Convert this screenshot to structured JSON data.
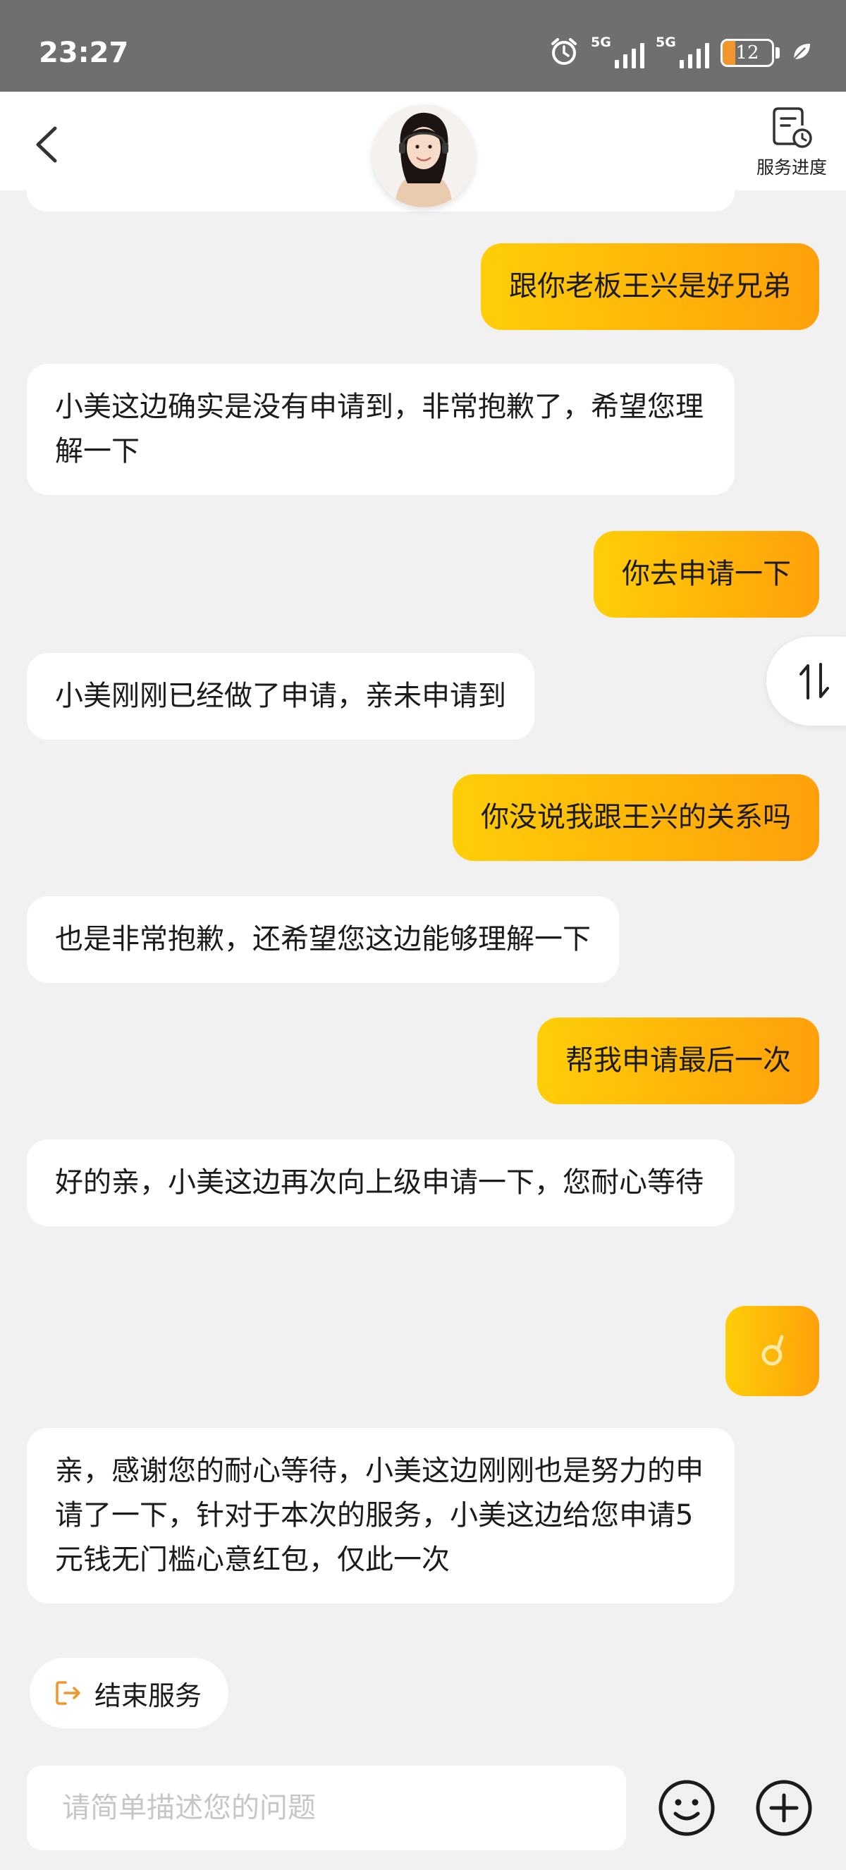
{
  "status_bar": {
    "time": "23:27",
    "signal_1_label": "5G",
    "signal_2_label": "5G",
    "battery_level": "12"
  },
  "header": {
    "progress_label": "服务进度"
  },
  "messages": [
    {
      "side": "user",
      "text": "跟你老板王兴是好兄弟"
    },
    {
      "side": "agent",
      "text": "小美这边确实是没有申请到，非常抱歉了，希望您理解一下"
    },
    {
      "side": "user",
      "text": "你去申请一下"
    },
    {
      "side": "agent",
      "text": "小美刚刚已经做了申请，亲未申请到"
    },
    {
      "side": "user",
      "text": "你没说我跟王兴的关系吗"
    },
    {
      "side": "agent",
      "text": "也是非常抱歉，还希望您这边能够理解一下"
    },
    {
      "side": "user",
      "text": "帮我申请最后一次"
    },
    {
      "side": "agent",
      "text": "好的亲，小美这边再次向上级申请一下，您耐心等待"
    },
    {
      "side": "user",
      "emoji": "ok-hand"
    },
    {
      "side": "agent",
      "text": "亲，感谢您的耐心等待，小美这边刚刚也是努力的申请了一下，针对于本次的服务，小美这边给您申请5元钱无门槛心意红包，仅此一次"
    }
  ],
  "bottom": {
    "end_service_label": "结束服务",
    "input_placeholder": "请简单描述您的问题"
  },
  "colors": {
    "user_bubble_start": "#fece08",
    "user_bubble_end": "#ffa00a",
    "accent_orange": "#f0962c",
    "background": "#f1f1f1"
  }
}
